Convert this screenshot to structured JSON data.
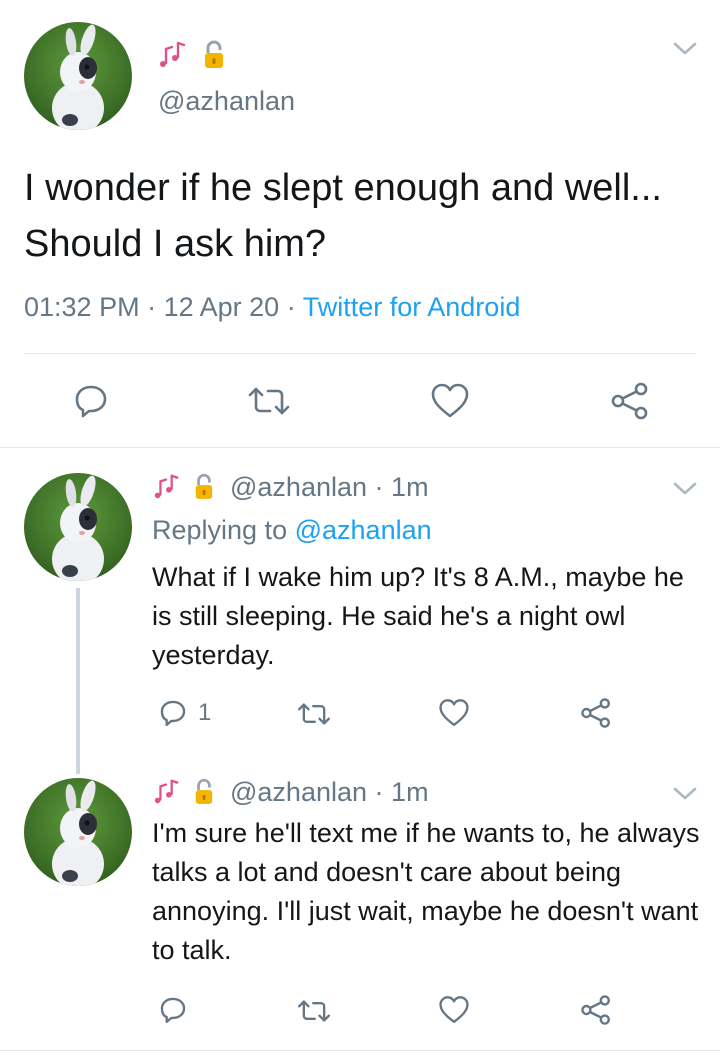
{
  "colors": {
    "accent": "#1da1f2",
    "muted": "#657786",
    "text": "#14171a",
    "divider": "#e1e8ed",
    "thread_line": "#ccd6dd"
  },
  "main_tweet": {
    "display_name_icons": [
      "musical-notes-icon",
      "lock-icon"
    ],
    "handle": "@azhanlan",
    "text": "I wonder if he slept enough and well... Should I ask him?",
    "time": "01:32 PM",
    "date": "12 Apr 20",
    "sep": "·",
    "client": "Twitter for Android"
  },
  "replies": [
    {
      "handle": "@azhanlan",
      "time": "1m",
      "sep": "·",
      "replying_label": "Replying to",
      "replying_to": "@azhanlan",
      "text": "What if I wake him up? It's 8 A.M., maybe he is still sleeping. He said he's a night owl yesterday.",
      "reply_count": "1"
    },
    {
      "handle": "@azhanlan",
      "time": "1m",
      "sep": "·",
      "text": "I'm sure he'll text me if he wants to, he always talks a lot and doesn't care about being annoying. I'll just wait, maybe he doesn't want to talk."
    }
  ]
}
